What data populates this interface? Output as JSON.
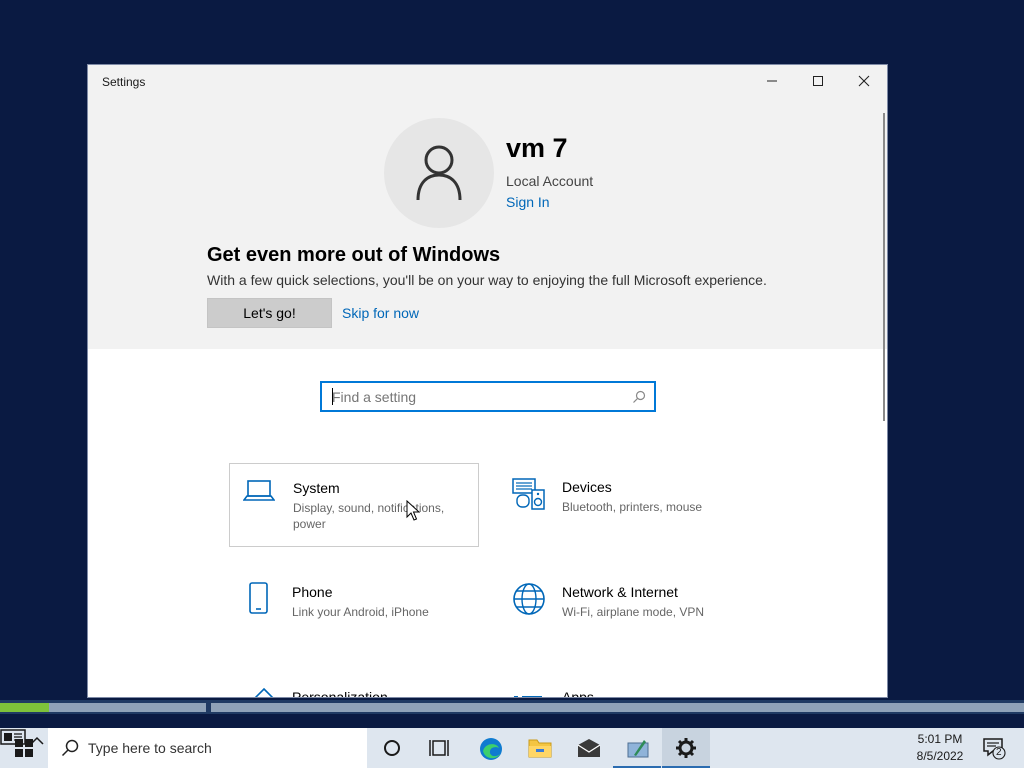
{
  "window": {
    "title": "Settings"
  },
  "account": {
    "name": "vm 7",
    "type": "Local Account",
    "sign_in": "Sign In"
  },
  "promo": {
    "title": "Get even more out of Windows",
    "text": "With a few quick selections, you'll be on your way to enjoying the full Microsoft experience.",
    "primary_button": "Let's go!",
    "secondary_link": "Skip for now"
  },
  "search": {
    "placeholder": "Find a setting"
  },
  "categories": [
    {
      "name": "System",
      "description": "Display, sound, notifications, power",
      "icon": "laptop-icon"
    },
    {
      "name": "Devices",
      "description": "Bluetooth, printers, mouse",
      "icon": "devices-icon"
    },
    {
      "name": "Phone",
      "description": "Link your Android, iPhone",
      "icon": "phone-icon"
    },
    {
      "name": "Network & Internet",
      "description": "Wi-Fi, airplane mode, VPN",
      "icon": "globe-icon"
    },
    {
      "name": "Personalization",
      "description": "",
      "icon": "brush-icon"
    },
    {
      "name": "Apps",
      "description": "",
      "icon": "apps-list-icon"
    }
  ],
  "progress": {
    "fraction": 0.24
  },
  "taskbar": {
    "search_placeholder": "Type here to search",
    "time": "5:01 PM",
    "date": "8/5/2022",
    "notification_count": "2"
  },
  "colors": {
    "accent": "#0078d7",
    "link": "#0067b8",
    "desktop": "#0a1a42",
    "taskbar": "#dee6ef"
  }
}
